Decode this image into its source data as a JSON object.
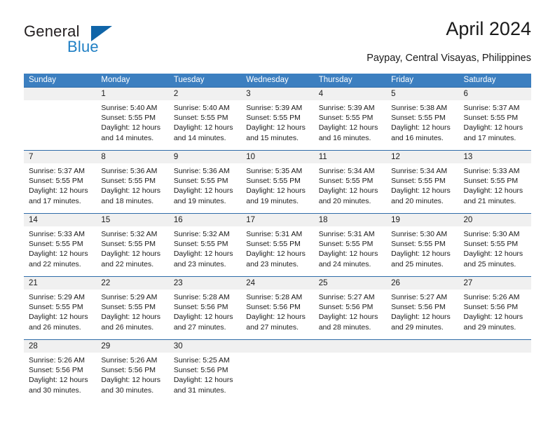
{
  "brand": {
    "name_part1": "General",
    "name_part2": "Blue",
    "accent_color": "#1065a8"
  },
  "header": {
    "title": "April 2024",
    "subtitle": "Paypay, Central Visayas, Philippines"
  },
  "calendar": {
    "header_bg": "#3c7fc0",
    "row_border_color": "#2f6ca8",
    "day_number_bg": "#f0f0f0",
    "weekday_headers": [
      "Sunday",
      "Monday",
      "Tuesday",
      "Wednesday",
      "Thursday",
      "Friday",
      "Saturday"
    ],
    "weeks": [
      [
        {
          "day": "",
          "sunrise": "",
          "sunset": "",
          "daylight_line1": "",
          "daylight_line2": ""
        },
        {
          "day": "1",
          "sunrise": "Sunrise: 5:40 AM",
          "sunset": "Sunset: 5:55 PM",
          "daylight_line1": "Daylight: 12 hours",
          "daylight_line2": "and 14 minutes."
        },
        {
          "day": "2",
          "sunrise": "Sunrise: 5:40 AM",
          "sunset": "Sunset: 5:55 PM",
          "daylight_line1": "Daylight: 12 hours",
          "daylight_line2": "and 14 minutes."
        },
        {
          "day": "3",
          "sunrise": "Sunrise: 5:39 AM",
          "sunset": "Sunset: 5:55 PM",
          "daylight_line1": "Daylight: 12 hours",
          "daylight_line2": "and 15 minutes."
        },
        {
          "day": "4",
          "sunrise": "Sunrise: 5:39 AM",
          "sunset": "Sunset: 5:55 PM",
          "daylight_line1": "Daylight: 12 hours",
          "daylight_line2": "and 16 minutes."
        },
        {
          "day": "5",
          "sunrise": "Sunrise: 5:38 AM",
          "sunset": "Sunset: 5:55 PM",
          "daylight_line1": "Daylight: 12 hours",
          "daylight_line2": "and 16 minutes."
        },
        {
          "day": "6",
          "sunrise": "Sunrise: 5:37 AM",
          "sunset": "Sunset: 5:55 PM",
          "daylight_line1": "Daylight: 12 hours",
          "daylight_line2": "and 17 minutes."
        }
      ],
      [
        {
          "day": "7",
          "sunrise": "Sunrise: 5:37 AM",
          "sunset": "Sunset: 5:55 PM",
          "daylight_line1": "Daylight: 12 hours",
          "daylight_line2": "and 17 minutes."
        },
        {
          "day": "8",
          "sunrise": "Sunrise: 5:36 AM",
          "sunset": "Sunset: 5:55 PM",
          "daylight_line1": "Daylight: 12 hours",
          "daylight_line2": "and 18 minutes."
        },
        {
          "day": "9",
          "sunrise": "Sunrise: 5:36 AM",
          "sunset": "Sunset: 5:55 PM",
          "daylight_line1": "Daylight: 12 hours",
          "daylight_line2": "and 19 minutes."
        },
        {
          "day": "10",
          "sunrise": "Sunrise: 5:35 AM",
          "sunset": "Sunset: 5:55 PM",
          "daylight_line1": "Daylight: 12 hours",
          "daylight_line2": "and 19 minutes."
        },
        {
          "day": "11",
          "sunrise": "Sunrise: 5:34 AM",
          "sunset": "Sunset: 5:55 PM",
          "daylight_line1": "Daylight: 12 hours",
          "daylight_line2": "and 20 minutes."
        },
        {
          "day": "12",
          "sunrise": "Sunrise: 5:34 AM",
          "sunset": "Sunset: 5:55 PM",
          "daylight_line1": "Daylight: 12 hours",
          "daylight_line2": "and 20 minutes."
        },
        {
          "day": "13",
          "sunrise": "Sunrise: 5:33 AM",
          "sunset": "Sunset: 5:55 PM",
          "daylight_line1": "Daylight: 12 hours",
          "daylight_line2": "and 21 minutes."
        }
      ],
      [
        {
          "day": "14",
          "sunrise": "Sunrise: 5:33 AM",
          "sunset": "Sunset: 5:55 PM",
          "daylight_line1": "Daylight: 12 hours",
          "daylight_line2": "and 22 minutes."
        },
        {
          "day": "15",
          "sunrise": "Sunrise: 5:32 AM",
          "sunset": "Sunset: 5:55 PM",
          "daylight_line1": "Daylight: 12 hours",
          "daylight_line2": "and 22 minutes."
        },
        {
          "day": "16",
          "sunrise": "Sunrise: 5:32 AM",
          "sunset": "Sunset: 5:55 PM",
          "daylight_line1": "Daylight: 12 hours",
          "daylight_line2": "and 23 minutes."
        },
        {
          "day": "17",
          "sunrise": "Sunrise: 5:31 AM",
          "sunset": "Sunset: 5:55 PM",
          "daylight_line1": "Daylight: 12 hours",
          "daylight_line2": "and 23 minutes."
        },
        {
          "day": "18",
          "sunrise": "Sunrise: 5:31 AM",
          "sunset": "Sunset: 5:55 PM",
          "daylight_line1": "Daylight: 12 hours",
          "daylight_line2": "and 24 minutes."
        },
        {
          "day": "19",
          "sunrise": "Sunrise: 5:30 AM",
          "sunset": "Sunset: 5:55 PM",
          "daylight_line1": "Daylight: 12 hours",
          "daylight_line2": "and 25 minutes."
        },
        {
          "day": "20",
          "sunrise": "Sunrise: 5:30 AM",
          "sunset": "Sunset: 5:55 PM",
          "daylight_line1": "Daylight: 12 hours",
          "daylight_line2": "and 25 minutes."
        }
      ],
      [
        {
          "day": "21",
          "sunrise": "Sunrise: 5:29 AM",
          "sunset": "Sunset: 5:55 PM",
          "daylight_line1": "Daylight: 12 hours",
          "daylight_line2": "and 26 minutes."
        },
        {
          "day": "22",
          "sunrise": "Sunrise: 5:29 AM",
          "sunset": "Sunset: 5:55 PM",
          "daylight_line1": "Daylight: 12 hours",
          "daylight_line2": "and 26 minutes."
        },
        {
          "day": "23",
          "sunrise": "Sunrise: 5:28 AM",
          "sunset": "Sunset: 5:56 PM",
          "daylight_line1": "Daylight: 12 hours",
          "daylight_line2": "and 27 minutes."
        },
        {
          "day": "24",
          "sunrise": "Sunrise: 5:28 AM",
          "sunset": "Sunset: 5:56 PM",
          "daylight_line1": "Daylight: 12 hours",
          "daylight_line2": "and 27 minutes."
        },
        {
          "day": "25",
          "sunrise": "Sunrise: 5:27 AM",
          "sunset": "Sunset: 5:56 PM",
          "daylight_line1": "Daylight: 12 hours",
          "daylight_line2": "and 28 minutes."
        },
        {
          "day": "26",
          "sunrise": "Sunrise: 5:27 AM",
          "sunset": "Sunset: 5:56 PM",
          "daylight_line1": "Daylight: 12 hours",
          "daylight_line2": "and 29 minutes."
        },
        {
          "day": "27",
          "sunrise": "Sunrise: 5:26 AM",
          "sunset": "Sunset: 5:56 PM",
          "daylight_line1": "Daylight: 12 hours",
          "daylight_line2": "and 29 minutes."
        }
      ],
      [
        {
          "day": "28",
          "sunrise": "Sunrise: 5:26 AM",
          "sunset": "Sunset: 5:56 PM",
          "daylight_line1": "Daylight: 12 hours",
          "daylight_line2": "and 30 minutes."
        },
        {
          "day": "29",
          "sunrise": "Sunrise: 5:26 AM",
          "sunset": "Sunset: 5:56 PM",
          "daylight_line1": "Daylight: 12 hours",
          "daylight_line2": "and 30 minutes."
        },
        {
          "day": "30",
          "sunrise": "Sunrise: 5:25 AM",
          "sunset": "Sunset: 5:56 PM",
          "daylight_line1": "Daylight: 12 hours",
          "daylight_line2": "and 31 minutes."
        },
        {
          "day": "",
          "sunrise": "",
          "sunset": "",
          "daylight_line1": "",
          "daylight_line2": ""
        },
        {
          "day": "",
          "sunrise": "",
          "sunset": "",
          "daylight_line1": "",
          "daylight_line2": ""
        },
        {
          "day": "",
          "sunrise": "",
          "sunset": "",
          "daylight_line1": "",
          "daylight_line2": ""
        },
        {
          "day": "",
          "sunrise": "",
          "sunset": "",
          "daylight_line1": "",
          "daylight_line2": ""
        }
      ]
    ]
  }
}
